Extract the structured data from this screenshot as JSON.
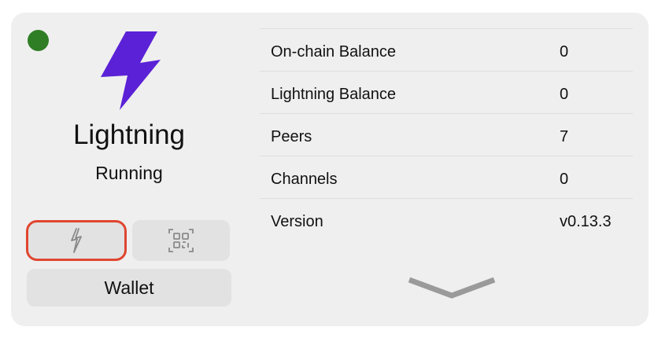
{
  "app": {
    "name": "Lightning",
    "status": "Running",
    "status_color": "#2f7d25",
    "logo_icon": "lightning-bolt-icon",
    "logo_color": "#5b21d6"
  },
  "actions": {
    "lightning_icon": "lightning-bolt-icon",
    "qr_icon": "qr-scan-icon",
    "wallet_label": "Wallet",
    "highlight_color": "#e0452f"
  },
  "info": {
    "rows": [
      {
        "label": "On-chain Balance",
        "value": "0"
      },
      {
        "label": "Lightning Balance",
        "value": "0"
      },
      {
        "label": "Peers",
        "value": "7"
      },
      {
        "label": "Channels",
        "value": "0"
      },
      {
        "label": "Version",
        "value": "v0.13.3"
      }
    ]
  },
  "expand_icon": "chevron-down-icon"
}
